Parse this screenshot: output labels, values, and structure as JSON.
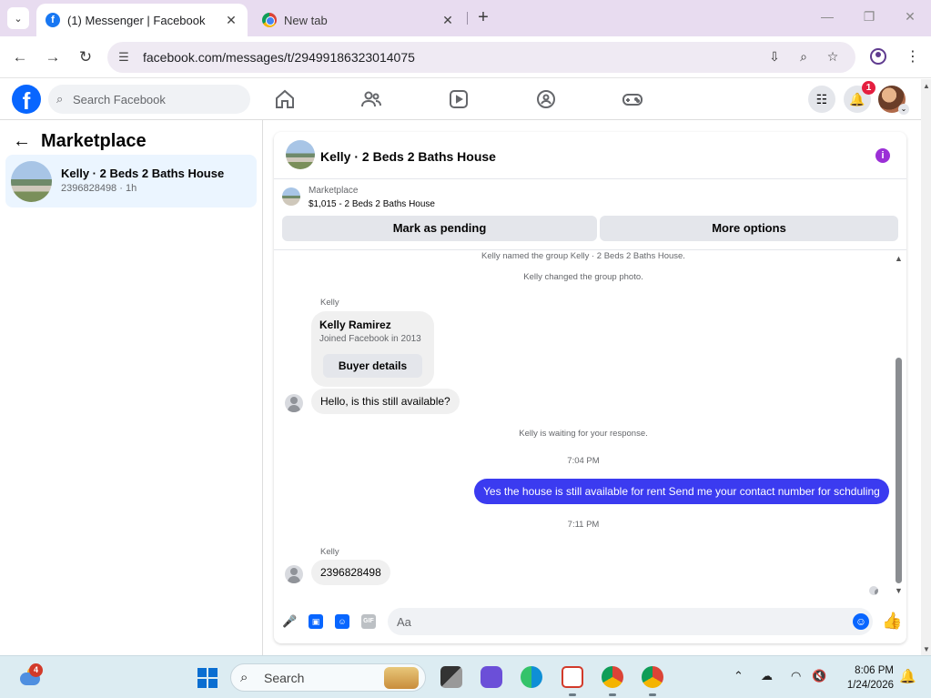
{
  "browser": {
    "tabs": [
      {
        "title": "(1) Messenger | Facebook",
        "active": true
      },
      {
        "title": "New tab",
        "active": false
      }
    ],
    "url": "facebook.com/messages/t/29499186323014075"
  },
  "facebook": {
    "search_placeholder": "Search Facebook",
    "notification_count": "1"
  },
  "sidebar": {
    "title": "Marketplace",
    "conversations": [
      {
        "name": "Kelly · 2 Beds 2 Baths House",
        "preview": "2396828498 · 1h"
      }
    ]
  },
  "chat": {
    "title": "Kelly · 2 Beds 2 Baths House",
    "listing": {
      "label": "Marketplace",
      "price_line": "$1,015 - 2 Beds 2 Baths House",
      "mark_pending": "Mark as pending",
      "more_options": "More options"
    },
    "system_messages": [
      "Kelly named the group Kelly · 2 Beds 2 Baths House.",
      "Kelly changed the group photo.",
      "Kelly is waiting for your response."
    ],
    "sender_name": "Kelly",
    "buyer_card": {
      "name": "Kelly Ramirez",
      "joined": "Joined Facebook in 2013",
      "button": "Buyer details"
    },
    "messages": [
      {
        "from": "Kelly",
        "text": "Hello, is this still available?"
      },
      {
        "from": "me",
        "text": "Yes the house is still available for rent Send me your contact number for schduling"
      },
      {
        "from": "Kelly",
        "text": "2396828498"
      }
    ],
    "timestamps": [
      "7:04 PM",
      "7:11 PM"
    ],
    "composer_placeholder": "Aa",
    "composer_gif": "GIF"
  },
  "taskbar": {
    "search_placeholder": "Search",
    "weather_badge": "4",
    "time": "8:06 PM",
    "date": "1/24/2026"
  },
  "colors": {
    "facebook_blue": "#0866ff",
    "outgoing_bubble": "#3b3bf0",
    "info_purple": "#9b2fd6",
    "notification_red": "#e41e3f"
  }
}
